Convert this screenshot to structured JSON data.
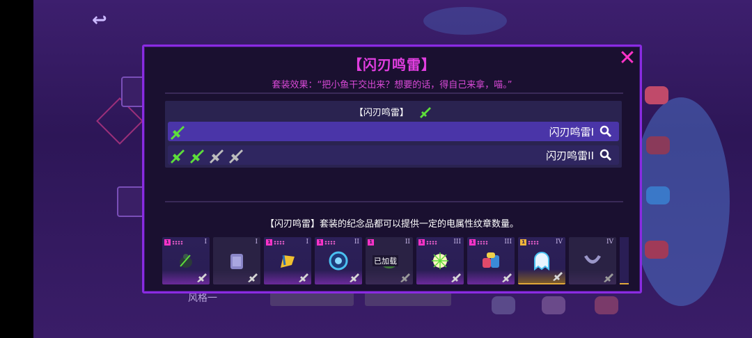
{
  "background": {
    "style_label": "风格一",
    "button_left_label": "",
    "button_right_label": ""
  },
  "modal": {
    "title": "【闪刃鸣雷】",
    "close_icon": "close-icon",
    "set_effect": "套装效果：“把小鱼干交出来？想要的话，得自己来拿，喵。”",
    "set_header": "【闪刃鸣雷】",
    "tiers": [
      {
        "name": "闪刃鸣雷I",
        "active_swords": 1,
        "total_swords": 1
      },
      {
        "name": "闪刃鸣雷II",
        "active_swords": 2,
        "total_swords": 4
      }
    ],
    "description": "【闪刃鸣雷】套装的纪念品都可以提供一定的电属性纹章数量。",
    "items": [
      {
        "roman": "I",
        "badge": "1",
        "art": "beetle-icon",
        "style": "pink"
      },
      {
        "roman": "I",
        "badge": "",
        "art": "scroll-icon",
        "style": "dim"
      },
      {
        "roman": "I",
        "badge": "1",
        "art": "flag-icon",
        "style": "pink"
      },
      {
        "roman": "II",
        "badge": "1",
        "art": "orb-icon",
        "style": "pink"
      },
      {
        "roman": "II",
        "badge": "1",
        "art": "frog-icon",
        "style": "dim",
        "overlay": "已加载"
      },
      {
        "roman": "III",
        "badge": "1",
        "art": "spark-icon",
        "style": "pink"
      },
      {
        "roman": "III",
        "badge": "1",
        "art": "jars-icon",
        "style": "pink"
      },
      {
        "roman": "IV",
        "badge": "1",
        "art": "ghost-icon",
        "style": "gold"
      },
      {
        "roman": "IV",
        "badge": "",
        "art": "collar-icon",
        "style": "dim"
      }
    ]
  },
  "colors": {
    "accent_magenta": "#e23ee0",
    "frame_purple": "#8a2be2",
    "active_row": "#4a35a8",
    "sword_green": "#5dde3a"
  }
}
